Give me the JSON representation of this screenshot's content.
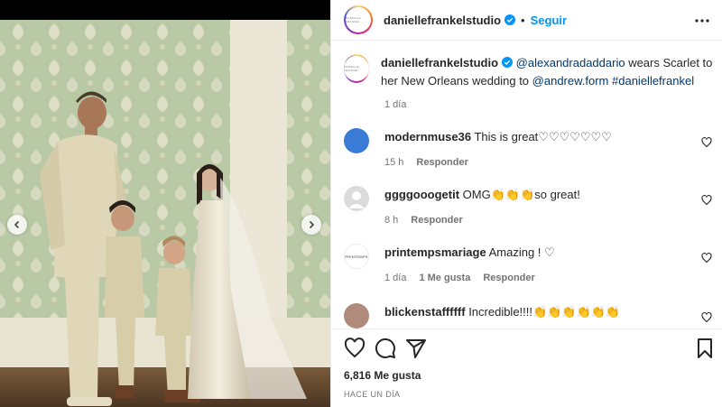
{
  "post": {
    "username": "daniellefrankelstudio",
    "follow_label": "Seguir",
    "header_dot": "•",
    "avatar_text": "DANIELLE FRANKEL",
    "caption": {
      "mention_1": "@alexandradaddario",
      "text_1": " wears Scarlet to her New Orleans wedding to ",
      "mention_2": "@andrew.form",
      "hashtag": "#daniellefrankel",
      "age": "1 día"
    }
  },
  "comments": [
    {
      "username": "modernmuse36",
      "text": "This is great♡♡♡♡♡♡♡",
      "age": "15 h",
      "likes": "",
      "reply": "Responder",
      "avatar_color": "#3a7bd5"
    },
    {
      "username": "ggggooogetit",
      "text": "OMG👏👏👏so great!",
      "age": "8 h",
      "likes": "",
      "reply": "Responder",
      "avatar_color": "#dbdbdb"
    },
    {
      "username": "printempsmariage",
      "text": "Amazing ! ♡",
      "age": "1 día",
      "likes": "1 Me gusta",
      "reply": "Responder",
      "avatar_color": "#ffffff",
      "avatar_text": "PRINTEMPS"
    },
    {
      "username": "blickenstaffffff",
      "text": "Incredible!!!!👏👏👏👏👏👏",
      "age": "",
      "likes": "",
      "reply": "",
      "avatar_color": "#b08a7a"
    }
  ],
  "footer": {
    "likes": "6,816 Me gusta",
    "timestamp": "HACE UN DÍA"
  },
  "colors": {
    "accent": "#0095f6",
    "mention": "#00376b",
    "muted": "#737373",
    "verified": "#0095f6"
  },
  "icons": [
    "chevron-left-icon",
    "chevron-right-icon",
    "verified-badge-icon",
    "more-icon",
    "heart-icon",
    "comment-icon",
    "share-icon",
    "bookmark-icon"
  ]
}
